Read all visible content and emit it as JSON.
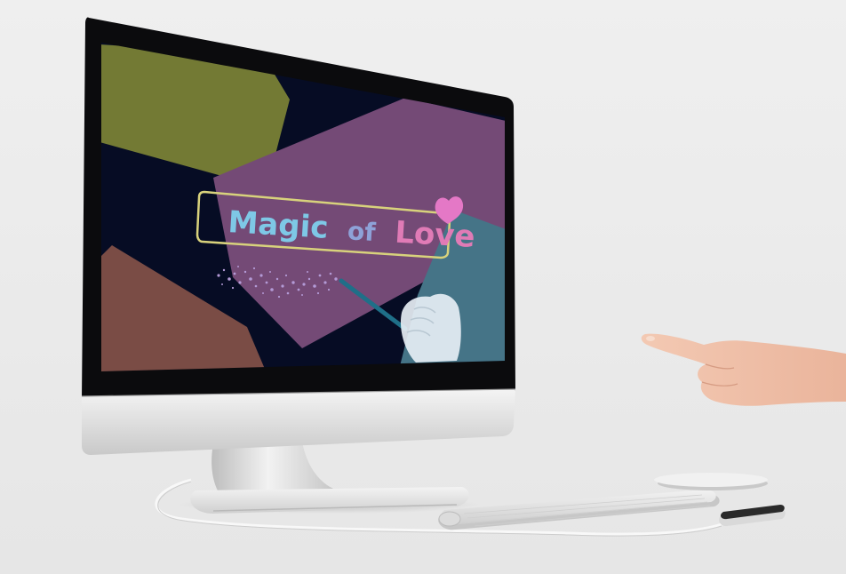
{
  "screen": {
    "title": {
      "word1": "Magic",
      "word2": "of",
      "word3": "Love"
    }
  },
  "colors": {
    "background": "#ebebeb",
    "screen_bg": "#060c24",
    "shape_olive": "#737a34",
    "shape_purple": "#744a76",
    "shape_brown": "#7a4c45",
    "shape_teal": "#457487",
    "title_blue": "#7ec8e6",
    "title_pink": "#e07bb6",
    "title_frame": "#d8d27c",
    "heart": "#e478c6",
    "sparkles": "#b39ad6"
  },
  "icons": [
    "heart-icon",
    "magic-wand-icon"
  ]
}
